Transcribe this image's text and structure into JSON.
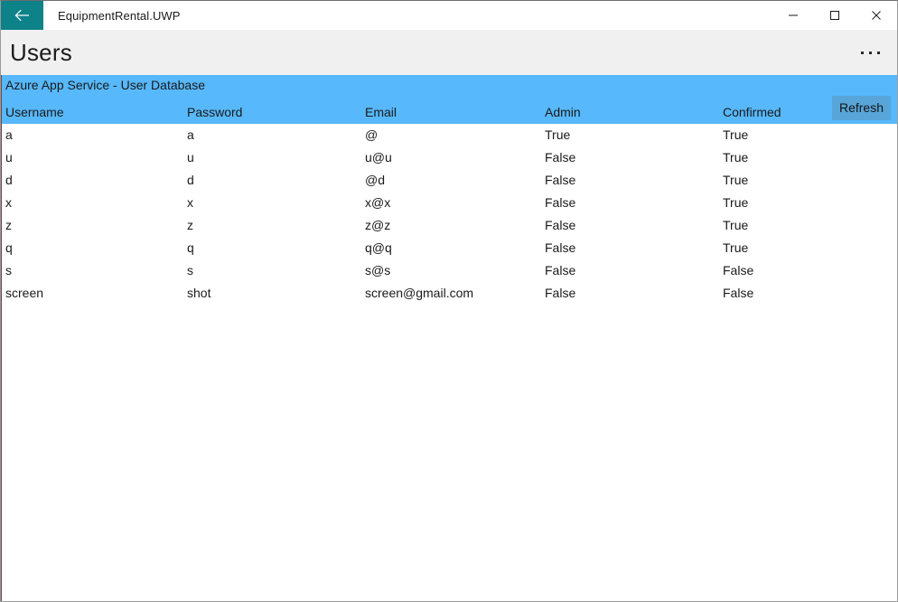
{
  "titlebar": {
    "back_icon": "back-arrow-icon",
    "app_title": "EquipmentRental.UWP",
    "minimize_label": "minimize-icon",
    "maximize_label": "maximize-icon",
    "close_label": "close-icon",
    "accent_color": "#0d8289"
  },
  "header": {
    "page_title": "Users",
    "more_label": "...",
    "background_color": "#f0f0f0"
  },
  "banner": {
    "title": "Azure App Service - User Database",
    "refresh_label": "Refresh",
    "background_color": "#57b8fb",
    "button_color": "#58a5d9"
  },
  "table": {
    "columns": [
      {
        "key": "username",
        "label": "Username"
      },
      {
        "key": "password",
        "label": "Password"
      },
      {
        "key": "email",
        "label": "Email"
      },
      {
        "key": "admin",
        "label": "Admin"
      },
      {
        "key": "confirmed",
        "label": "Confirmed"
      }
    ],
    "rows": [
      {
        "username": "a",
        "password": "a",
        "email": "@",
        "admin": "True",
        "confirmed": "True"
      },
      {
        "username": "u",
        "password": "u",
        "email": "u@u",
        "admin": "False",
        "confirmed": "True"
      },
      {
        "username": "d",
        "password": "d",
        "email": "@d",
        "admin": "False",
        "confirmed": "True"
      },
      {
        "username": "x",
        "password": "x",
        "email": "x@x",
        "admin": "False",
        "confirmed": "True"
      },
      {
        "username": "z",
        "password": "z",
        "email": "z@z",
        "admin": "False",
        "confirmed": "True"
      },
      {
        "username": "q",
        "password": "q",
        "email": "q@q",
        "admin": "False",
        "confirmed": "True"
      },
      {
        "username": "s",
        "password": "s",
        "email": "s@s",
        "admin": "False",
        "confirmed": "False"
      },
      {
        "username": "screen",
        "password": "shot",
        "email": "screen@gmail.com",
        "admin": "False",
        "confirmed": "False"
      }
    ]
  }
}
